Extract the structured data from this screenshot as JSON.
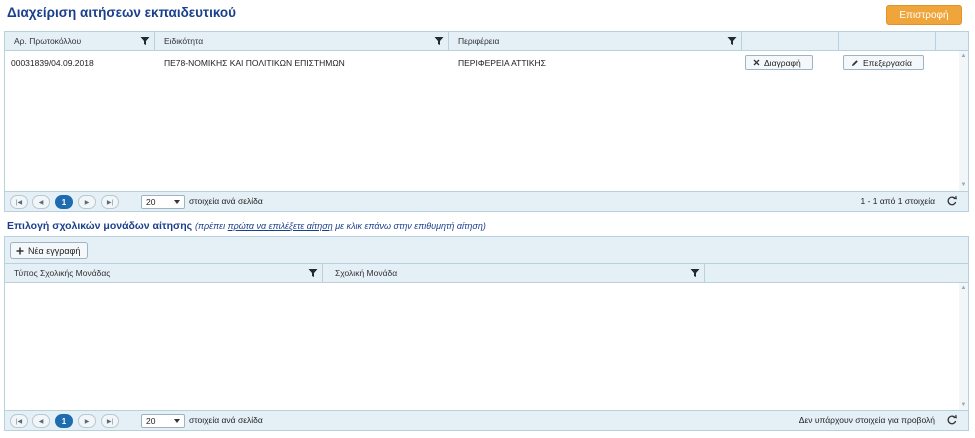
{
  "page": {
    "title": "Διαχείριση αιτήσεων εκπαιδευτικού",
    "back_label": "Επιστροφή"
  },
  "grid1": {
    "columns": [
      "Αρ. Πρωτοκόλλου",
      "Ειδικότητα",
      "Περιφέρεια",
      "",
      ""
    ],
    "rows": [
      {
        "protocol": "00031839/04.09.2018",
        "specialty": "ΠΕ78-ΝΟΜΙΚΗΣ ΚΑΙ ΠΟΛΙΤΙΚΩΝ ΕΠΙΣΤΗΜΩΝ",
        "region": "ΠΕΡΙΦΕΡΕΙΑ ΑΤΤΙΚΗΣ",
        "delete_label": "Διαγραφή",
        "edit_label": "Επεξεργασία"
      }
    ],
    "pager": {
      "current_page": "1",
      "page_size": "20",
      "per_page_label": "στοιχεία ανά σελίδα",
      "info": "1 - 1 από 1 στοιχεία"
    }
  },
  "section2": {
    "title": "Επιλογή σχολικών μονάδων αίτησης",
    "note_prefix": "(πρέπει ",
    "note_link": "πρώτα να επιλέξετε αίτηση",
    "note_suffix": " με κλικ επάνω στην επιθυμητή αίτηση)"
  },
  "grid2": {
    "new_label": "Νέα εγγραφή",
    "columns": [
      "Τύπος Σχολικής Μονάδας",
      "Σχολική Μονάδα",
      ""
    ],
    "pager": {
      "current_page": "1",
      "page_size": "20",
      "per_page_label": "στοιχεία ανά σελίδα",
      "info": "Δεν υπάρχουν στοιχεία για προβολή"
    }
  },
  "colors": {
    "title": "#1a3f8c",
    "accent_button": "#f0a53b",
    "header_bg": "#e4eff6",
    "active_page": "#1e6bb0"
  },
  "icons": [
    "filter-icon",
    "close-icon",
    "pencil-icon",
    "plus-icon",
    "first-page-icon",
    "prev-page-icon",
    "next-page-icon",
    "last-page-icon",
    "refresh-icon"
  ]
}
